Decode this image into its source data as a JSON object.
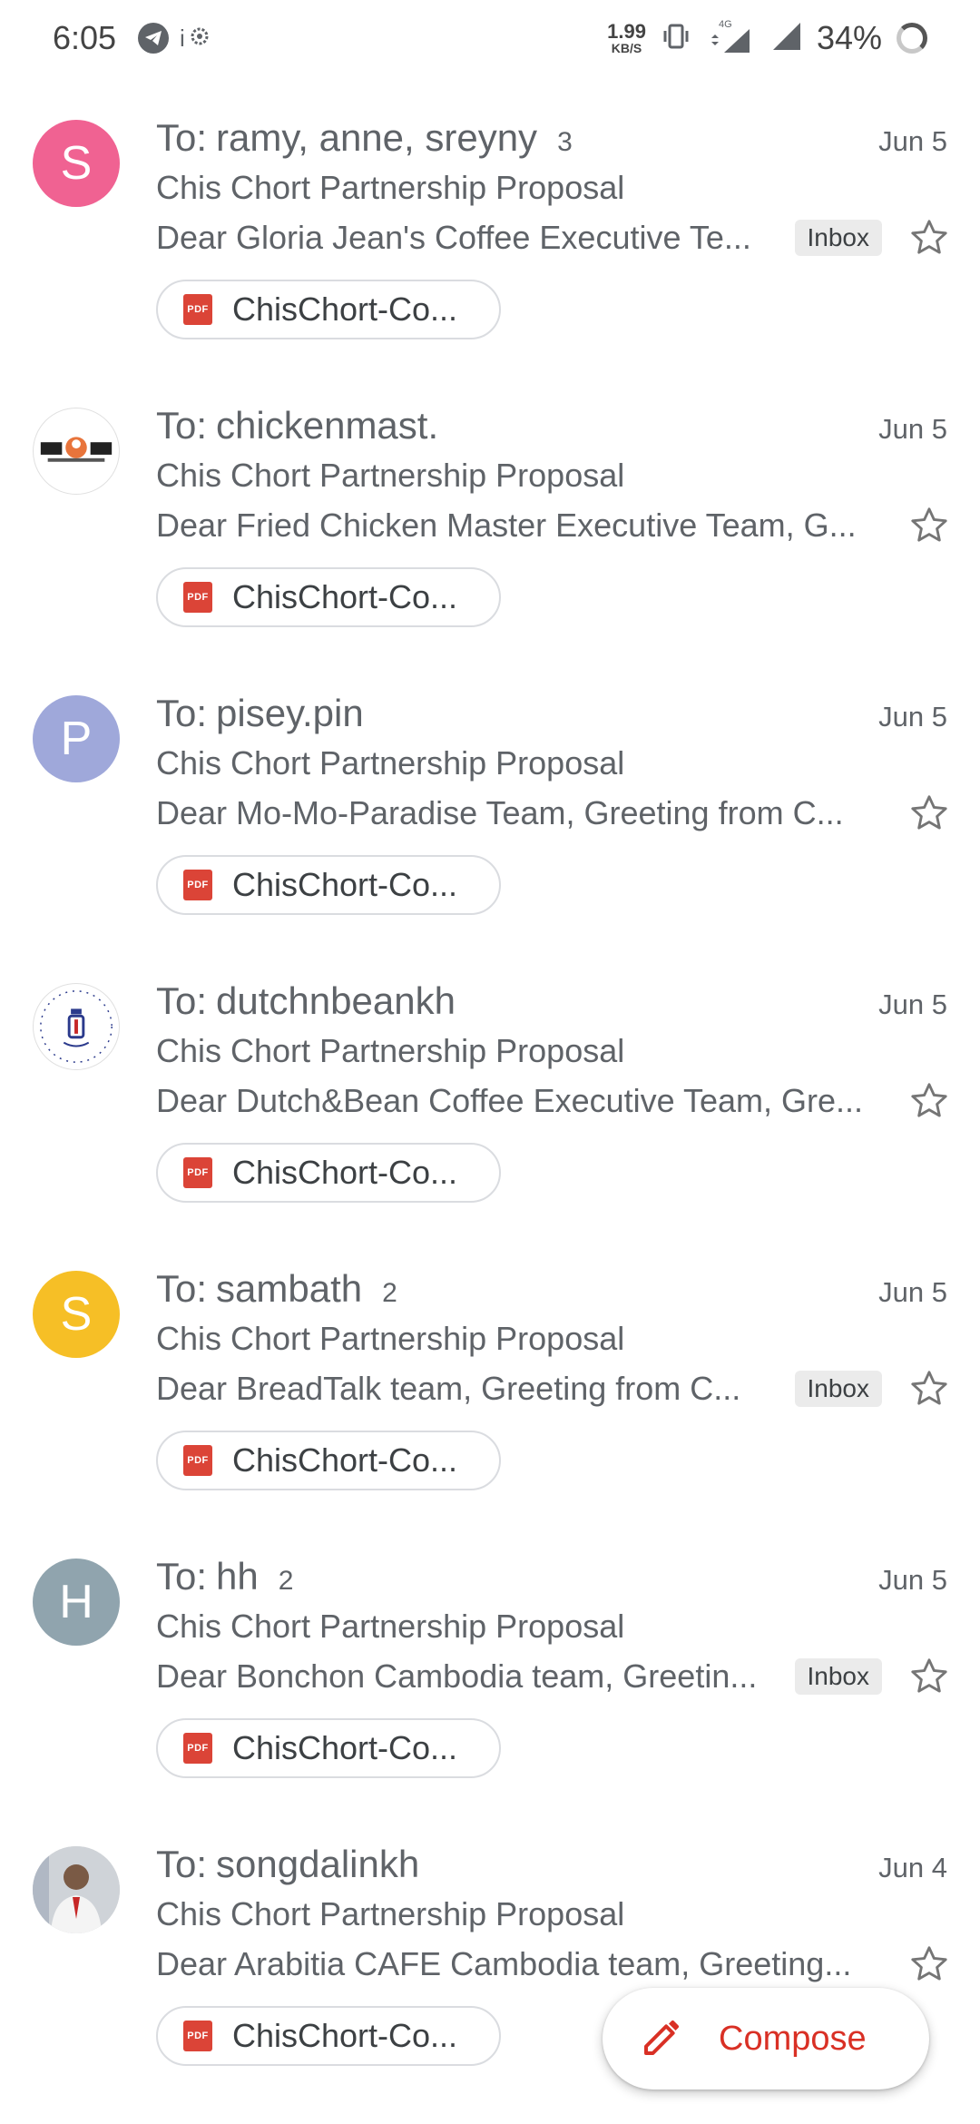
{
  "status_bar": {
    "time": "6:05",
    "speed_value": "1.99",
    "speed_unit": "KB/S",
    "network": "4G",
    "battery": "34%"
  },
  "mails": [
    {
      "avatar_letter": "S",
      "avatar_color": "#f06292",
      "to_label": "To:",
      "to": "ramy, anne, sreyny",
      "count": "3",
      "date": "Jun 5",
      "subject": "Chis Chort Partnership Proposal",
      "snippet": "Dear Gloria Jean's Coffee Executive Te...",
      "badge": "Inbox",
      "attachment": "ChisChort-Co..."
    },
    {
      "avatar_letter": "",
      "avatar_image": "fried-chicken-master-logo",
      "to_label": "To:",
      "to": "chickenmast.",
      "count": "",
      "date": "Jun 5",
      "subject": "Chis Chort Partnership Proposal",
      "snippet": "Dear Fried Chicken Master Executive Team, G...",
      "badge": "",
      "attachment": "ChisChort-Co..."
    },
    {
      "avatar_letter": "P",
      "avatar_color": "#9fa8da",
      "to_label": "To:",
      "to": "pisey.pin",
      "count": "",
      "date": "Jun 5",
      "subject": "Chis Chort Partnership Proposal",
      "snippet": "Dear Mo-Mo-Paradise Team, Greeting from C...",
      "badge": "",
      "attachment": "ChisChort-Co..."
    },
    {
      "avatar_letter": "",
      "avatar_image": "dutch-and-bean-logo",
      "to_label": "To:",
      "to": "dutchnbeankh",
      "count": "",
      "date": "Jun 5",
      "subject": "Chis Chort Partnership Proposal",
      "snippet": "Dear Dutch&Bean Coffee Executive Team, Gre...",
      "badge": "",
      "attachment": "ChisChort-Co..."
    },
    {
      "avatar_letter": "S",
      "avatar_color": "#f6bf26",
      "to_label": "To:",
      "to": "sambath",
      "count": "2",
      "date": "Jun 5",
      "subject": "Chis Chort Partnership Proposal",
      "snippet": "Dear BreadTalk team, Greeting from C...",
      "badge": "Inbox",
      "attachment": "ChisChort-Co..."
    },
    {
      "avatar_letter": "H",
      "avatar_color": "#90a4ae",
      "to_label": "To:",
      "to": "hh",
      "count": "2",
      "date": "Jun 5",
      "subject": "Chis Chort Partnership Proposal",
      "snippet": "Dear Bonchon Cambodia team, Greetin...",
      "badge": "Inbox",
      "attachment": "ChisChort-Co..."
    },
    {
      "avatar_letter": "",
      "avatar_image": "person-photo",
      "to_label": "To:",
      "to": "songdalinkh",
      "count": "",
      "date": "Jun 4",
      "subject": "Chis Chort Partnership Proposal",
      "snippet": "Dear Arabitia CAFE Cambodia team, Greeting...",
      "badge": "",
      "attachment": "ChisChort-Co..."
    }
  ],
  "pdf_badge": "PDF",
  "compose": {
    "label": "Compose"
  },
  "colors": {
    "accent": "#d93025",
    "pdf": "#db4437",
    "text_secondary": "#5f6368"
  }
}
